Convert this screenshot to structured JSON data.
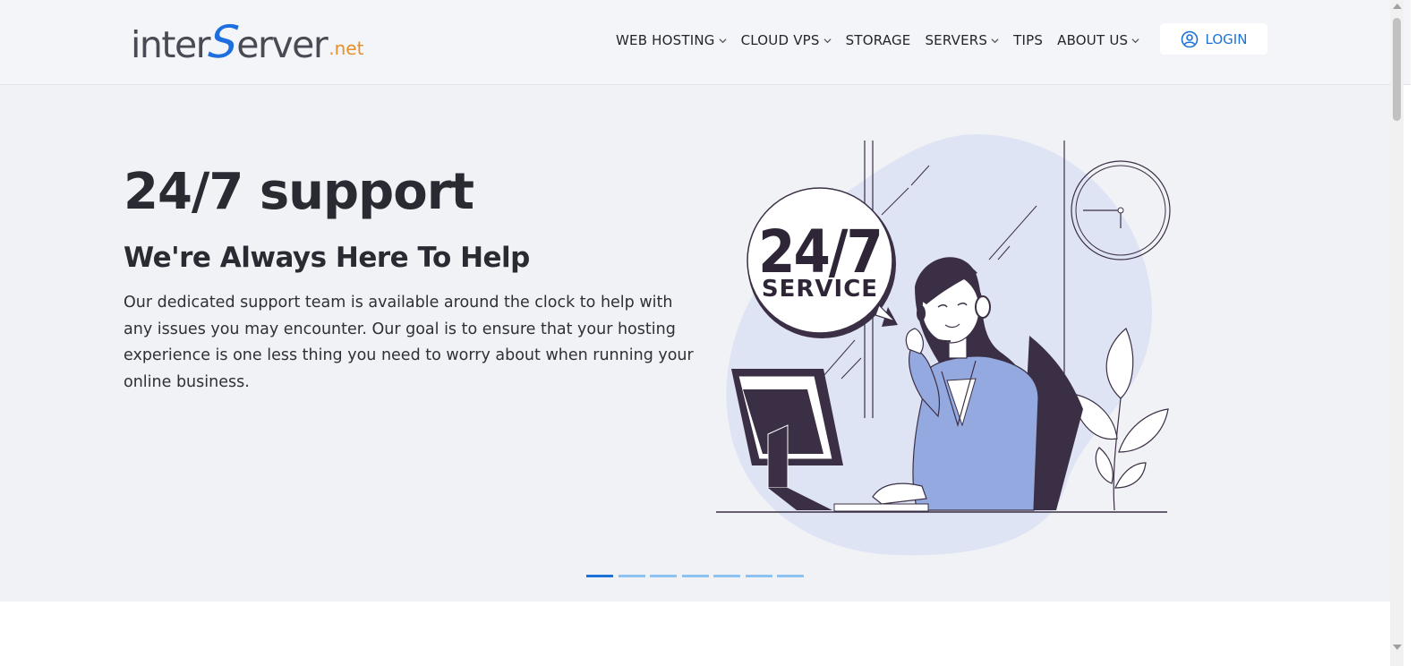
{
  "header": {
    "logo": {
      "part1": "inter",
      "part2": "S",
      "part3": "erver",
      "suffix": ".net"
    },
    "nav": [
      {
        "label": "WEB HOSTING",
        "dropdown": true
      },
      {
        "label": "CLOUD VPS",
        "dropdown": true
      },
      {
        "label": "STORAGE",
        "dropdown": false
      },
      {
        "label": "SERVERS",
        "dropdown": true
      },
      {
        "label": "TIPS",
        "dropdown": false
      },
      {
        "label": "ABOUT US",
        "dropdown": true
      }
    ],
    "login_label": "LOGIN"
  },
  "hero": {
    "title": "24/7 support",
    "subtitle": "We're Always Here To Help",
    "body": "Our dedicated support team is available around the clock to help with any issues you may encounter. Our goal is to ensure that your hosting experience is one less thing you need to worry about when running your online business.",
    "bubble_line1": "24/7",
    "bubble_line2": "SERVICE"
  },
  "carousel": {
    "slide_count": 7,
    "active_index": 0
  },
  "colors": {
    "accent_blue": "#1d72d8",
    "logo_orange": "#e7902b",
    "hero_bg": "#f1f2f6",
    "illus_blob": "#dfe4f5",
    "illus_dark": "#3b2f45",
    "illus_suit": "#94a9df"
  }
}
